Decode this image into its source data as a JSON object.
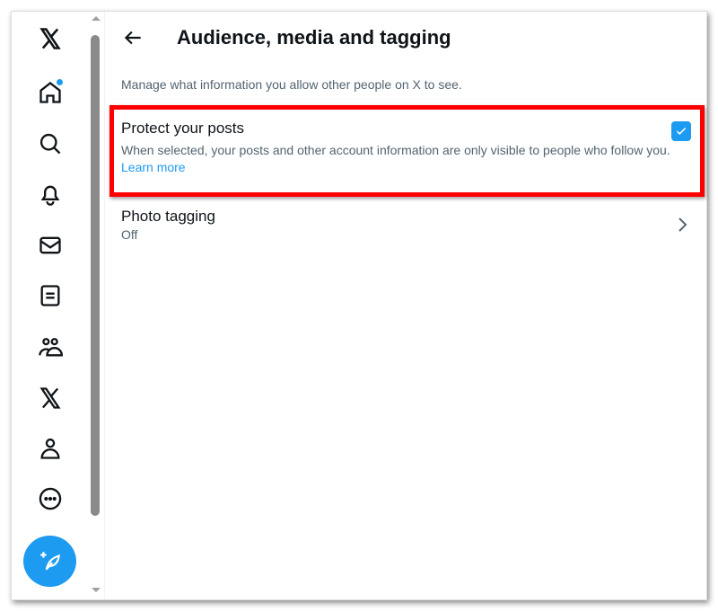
{
  "sidebar": {
    "items": [
      "X logo",
      "Home",
      "Explore",
      "Notifications",
      "Messages",
      "Lists",
      "Communities",
      "Premium",
      "Profile",
      "More"
    ],
    "post_button": "Post",
    "accent": "#1d9bf0"
  },
  "header": {
    "title": "Audience, media and tagging"
  },
  "main": {
    "description": "Manage what information you allow other people on X to see.",
    "protect": {
      "title": "Protect your posts",
      "text": "When selected, your posts and other account information are only visible to people who follow you.",
      "link": "Learn more",
      "checked": true
    },
    "photo_tagging": {
      "title": "Photo tagging",
      "value": "Off"
    }
  }
}
